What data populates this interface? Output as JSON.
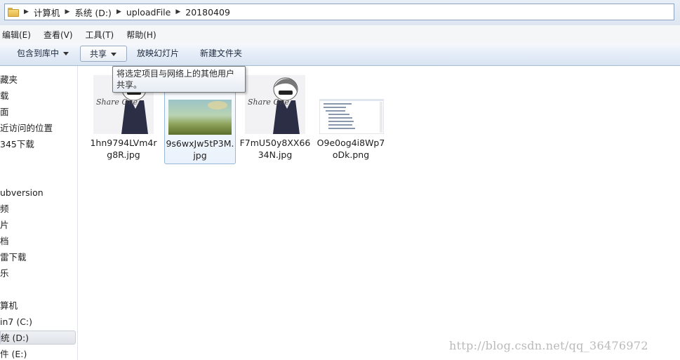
{
  "address": {
    "crumbs": [
      "计算机",
      "系统 (D:)",
      "uploadFile",
      "20180409"
    ]
  },
  "menu": [
    "编辑(E)",
    "查看(V)",
    "工具(T)",
    "帮助(H)"
  ],
  "toolbar": {
    "include_library": "包含到库中",
    "share": "共享",
    "slideshow": "放映幻灯片",
    "new_folder": "新建文件夹"
  },
  "tooltip": "将选定项目与网络上的其他用户共享。",
  "nav": [
    "藏夹",
    "载",
    "面",
    "近访问的位置",
    "345下载",
    "ubversion",
    "频",
    "片",
    "档",
    "雷下载",
    "乐",
    "算机",
    "in7 (C:)",
    "统 (D:)",
    "件 (E:)"
  ],
  "files": [
    {
      "name": "1hn9794LVm4rg8R.jpg",
      "thumb_text": "Share One"
    },
    {
      "name": "9s6wxJw5tP3M.jpg"
    },
    {
      "name": "F7mU50y8XX6634N.jpg",
      "thumb_text": "Share One"
    },
    {
      "name": "O9e0og4i8Wp7oDk.png"
    }
  ],
  "watermark": "http://blog.csdn.net/qq_36476972"
}
